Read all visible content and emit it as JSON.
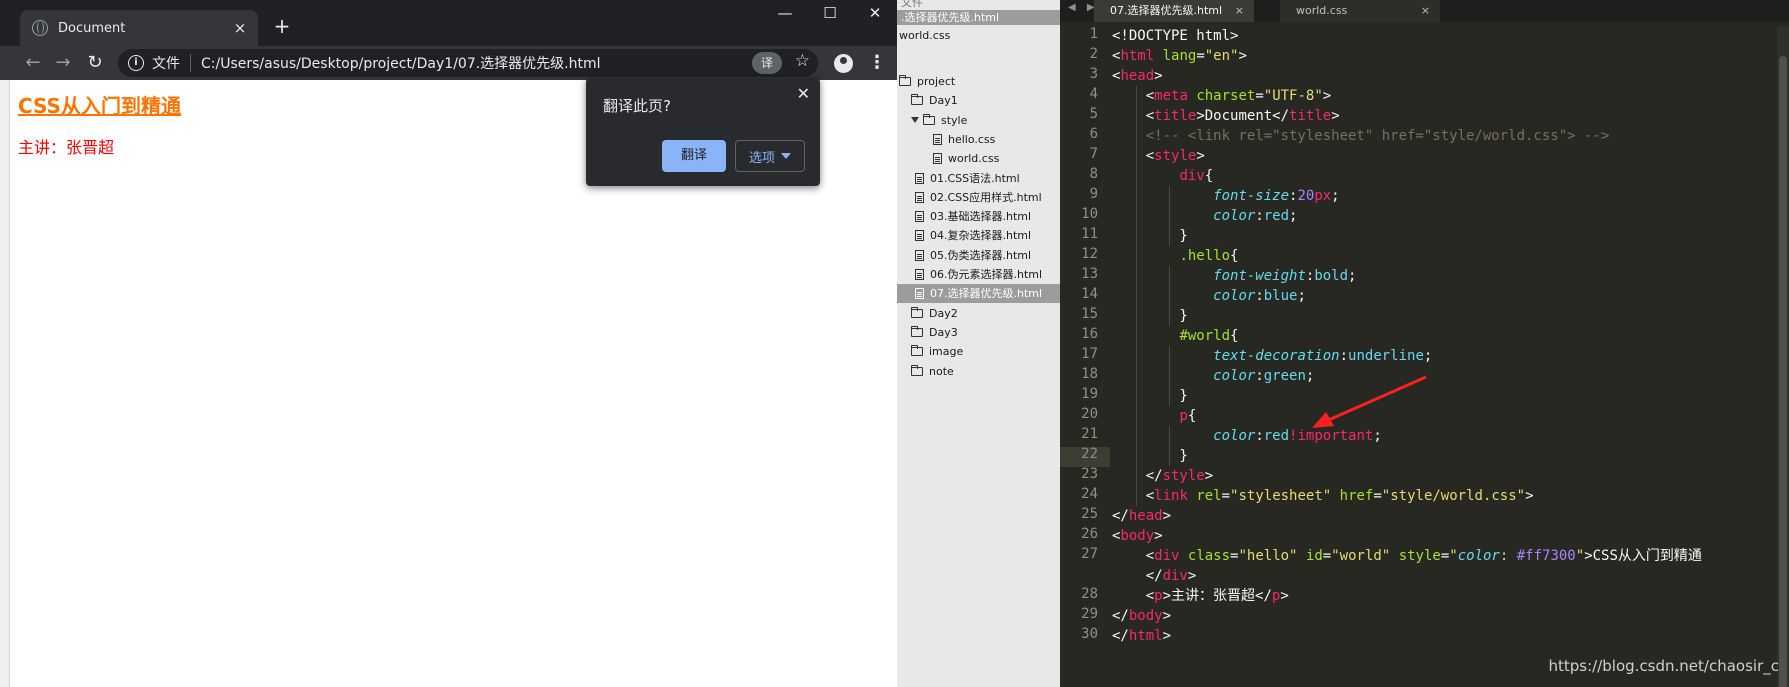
{
  "browser": {
    "tab_title": "Document",
    "tab_close": "×",
    "new_tab": "+",
    "minimize": "—",
    "maximize": "☐",
    "close": "✕",
    "scheme_label": "文件",
    "address": "C:/Users/asus/Desktop/project/Day1/07.选择器优先级.html",
    "translate_badge": "译",
    "page": {
      "heading": "CSS从入门到精通",
      "paragraph": "主讲：张晋超"
    },
    "translate_popup": {
      "prompt": "翻译此页?",
      "translate_button": "翻译",
      "options_button": "选项",
      "close": "✕"
    }
  },
  "sidebar": {
    "top_stub": "文件",
    "open_file_selected": ".选择器优先级.html",
    "open_file_2": "world.css",
    "tree": [
      {
        "label": "project",
        "type": "folder",
        "level": 0
      },
      {
        "label": "Day1",
        "type": "folder",
        "level": 1
      },
      {
        "label": "style",
        "type": "folder-open",
        "level": 2
      },
      {
        "label": "hello.css",
        "type": "file",
        "level": 3
      },
      {
        "label": "world.css",
        "type": "file",
        "level": 3
      },
      {
        "label": "01.CSS语法.html",
        "type": "file",
        "level": 2
      },
      {
        "label": "02.CSS应用样式.html",
        "type": "file",
        "level": 2
      },
      {
        "label": "03.基础选择器.html",
        "type": "file",
        "level": 2
      },
      {
        "label": "04.复杂选择器.html",
        "type": "file",
        "level": 2
      },
      {
        "label": "05.伪类选择器.html",
        "type": "file",
        "level": 2
      },
      {
        "label": "06.伪元素选择器.html",
        "type": "file",
        "level": 2
      },
      {
        "label": "07.选择器优先级.html",
        "type": "file",
        "level": 2,
        "selected": true
      },
      {
        "label": "Day2",
        "type": "folder",
        "level": 1
      },
      {
        "label": "Day3",
        "type": "folder",
        "level": 1
      },
      {
        "label": "image",
        "type": "folder",
        "level": 1
      },
      {
        "label": "note",
        "type": "folder",
        "level": 1
      }
    ]
  },
  "editor": {
    "tabs": [
      {
        "label": "07.选择器优先级.html",
        "active": true
      },
      {
        "label": "world.css",
        "active": false
      }
    ],
    "tab_close": "×",
    "line_numbers": [
      "1",
      "2",
      "3",
      "4",
      "5",
      "6",
      "7",
      "8",
      "9",
      "10",
      "11",
      "12",
      "13",
      "14",
      "15",
      "16",
      "17",
      "18",
      "19",
      "20",
      "21",
      "22",
      "23",
      "24",
      "25",
      "26",
      "27",
      "",
      "28",
      "29",
      "30"
    ],
    "lines": [
      [
        [
          "t-plain",
          "<!DOCTYPE html>"
        ]
      ],
      [
        [
          "t-plain",
          "<"
        ],
        [
          "t-tag",
          "html"
        ],
        [
          "t-plain",
          " "
        ],
        [
          "t-attr",
          "lang"
        ],
        [
          "t-plain",
          "="
        ],
        [
          "t-str",
          "\"en\""
        ],
        [
          "t-plain",
          ">"
        ]
      ],
      [
        [
          "t-plain",
          "<"
        ],
        [
          "t-tag",
          "head"
        ],
        [
          "t-plain",
          ">"
        ]
      ],
      [
        [
          "t-plain",
          "    <"
        ],
        [
          "t-tag",
          "meta"
        ],
        [
          "t-plain",
          " "
        ],
        [
          "t-attr",
          "charset"
        ],
        [
          "t-plain",
          "="
        ],
        [
          "t-str",
          "\"UTF-8\""
        ],
        [
          "t-plain",
          ">"
        ]
      ],
      [
        [
          "t-plain",
          "    <"
        ],
        [
          "t-tag",
          "title"
        ],
        [
          "t-plain",
          ">Document</"
        ],
        [
          "t-tag",
          "title"
        ],
        [
          "t-plain",
          ">"
        ]
      ],
      [
        [
          "t-com",
          "    <!-- <link rel=\"stylesheet\" href=\"style/world.css\"> -->"
        ]
      ],
      [
        [
          "t-plain",
          "    <"
        ],
        [
          "t-tag",
          "style"
        ],
        [
          "t-plain",
          ">"
        ]
      ],
      [
        [
          "t-plain",
          "        "
        ],
        [
          "t-tag",
          "div"
        ],
        [
          "t-plain",
          "{"
        ]
      ],
      [
        [
          "t-plain",
          "            "
        ],
        [
          "t-prop",
          "font-size"
        ],
        [
          "t-plain",
          ":"
        ],
        [
          "t-num",
          "20"
        ],
        [
          "t-tag",
          "px"
        ],
        [
          "t-plain",
          ";"
        ]
      ],
      [
        [
          "t-plain",
          "            "
        ],
        [
          "t-prop",
          "color"
        ],
        [
          "t-plain",
          ":"
        ],
        [
          "t-val",
          "red"
        ],
        [
          "t-plain",
          ";"
        ]
      ],
      [
        [
          "t-plain",
          "        }"
        ]
      ],
      [
        [
          "t-plain",
          "        "
        ],
        [
          "t-sel",
          ".hello"
        ],
        [
          "t-plain",
          "{"
        ]
      ],
      [
        [
          "t-plain",
          "            "
        ],
        [
          "t-prop",
          "font-weight"
        ],
        [
          "t-plain",
          ":"
        ],
        [
          "t-val",
          "bold"
        ],
        [
          "t-plain",
          ";"
        ]
      ],
      [
        [
          "t-plain",
          "            "
        ],
        [
          "t-prop",
          "color"
        ],
        [
          "t-plain",
          ":"
        ],
        [
          "t-val",
          "blue"
        ],
        [
          "t-plain",
          ";"
        ]
      ],
      [
        [
          "t-plain",
          "        }"
        ]
      ],
      [
        [
          "t-plain",
          "        "
        ],
        [
          "t-sel",
          "#world"
        ],
        [
          "t-plain",
          "{"
        ]
      ],
      [
        [
          "t-plain",
          "            "
        ],
        [
          "t-prop",
          "text-decoration"
        ],
        [
          "t-plain",
          ":"
        ],
        [
          "t-val",
          "underline"
        ],
        [
          "t-plain",
          ";"
        ]
      ],
      [
        [
          "t-plain",
          "            "
        ],
        [
          "t-prop",
          "color"
        ],
        [
          "t-plain",
          ":"
        ],
        [
          "t-val",
          "green"
        ],
        [
          "t-plain",
          ";"
        ]
      ],
      [
        [
          "t-plain",
          "        }"
        ]
      ],
      [
        [
          "t-plain",
          "        "
        ],
        [
          "t-tag",
          "p"
        ],
        [
          "t-plain",
          "{"
        ]
      ],
      [
        [
          "t-plain",
          "            "
        ],
        [
          "t-prop",
          "color"
        ],
        [
          "t-plain",
          ":"
        ],
        [
          "t-val",
          "red"
        ],
        [
          "t-imp",
          "!important"
        ],
        [
          "t-plain",
          ";"
        ]
      ],
      [
        [
          "t-plain",
          "        }"
        ]
      ],
      [
        [
          "t-plain",
          "    </"
        ],
        [
          "t-tag",
          "style"
        ],
        [
          "t-plain",
          ">"
        ]
      ],
      [
        [
          "t-plain",
          "    <"
        ],
        [
          "t-tag",
          "link"
        ],
        [
          "t-plain",
          " "
        ],
        [
          "t-attr",
          "rel"
        ],
        [
          "t-plain",
          "="
        ],
        [
          "t-str",
          "\"stylesheet\""
        ],
        [
          "t-plain",
          " "
        ],
        [
          "t-attr",
          "href"
        ],
        [
          "t-plain",
          "="
        ],
        [
          "t-str",
          "\"style/world.css\""
        ],
        [
          "t-plain",
          ">"
        ]
      ],
      [
        [
          "t-plain",
          "</"
        ],
        [
          "t-tag",
          "head"
        ],
        [
          "t-plain",
          ">"
        ]
      ],
      [
        [
          "t-plain",
          "<"
        ],
        [
          "t-tag",
          "body"
        ],
        [
          "t-plain",
          ">"
        ]
      ],
      [
        [
          "t-plain",
          "    <"
        ],
        [
          "t-tag",
          "div"
        ],
        [
          "t-plain",
          " "
        ],
        [
          "t-attr",
          "class"
        ],
        [
          "t-plain",
          "="
        ],
        [
          "t-str",
          "\"hello\""
        ],
        [
          "t-plain",
          " "
        ],
        [
          "t-attr",
          "id"
        ],
        [
          "t-plain",
          "="
        ],
        [
          "t-str",
          "\"world\""
        ],
        [
          "t-plain",
          " "
        ],
        [
          "t-attr",
          "style"
        ],
        [
          "t-plain",
          "="
        ],
        [
          "t-str",
          "\""
        ],
        [
          "t-prop",
          "color"
        ],
        [
          "t-str",
          ": "
        ],
        [
          "t-num",
          "#ff7300"
        ],
        [
          "t-str",
          "\""
        ],
        [
          "t-plain",
          ">CSS从入门到精通"
        ]
      ],
      [
        [
          "t-plain",
          "    </"
        ],
        [
          "t-tag",
          "div"
        ],
        [
          "t-plain",
          ">"
        ]
      ],
      [
        [
          "t-plain",
          "    <"
        ],
        [
          "t-tag",
          "p"
        ],
        [
          "t-plain",
          ">主讲：张晋超</"
        ],
        [
          "t-tag",
          "p"
        ],
        [
          "t-plain",
          ">"
        ]
      ],
      [
        [
          "t-plain",
          "</"
        ],
        [
          "t-tag",
          "body"
        ],
        [
          "t-plain",
          ">"
        ]
      ],
      [
        [
          "t-plain",
          "</"
        ],
        [
          "t-tag",
          "html"
        ],
        [
          "t-plain",
          ">"
        ]
      ]
    ],
    "watermark": "https://blog.csdn.net/chaosir_c"
  },
  "colors": {
    "heading": "#ff7300",
    "paragraph": "#ff0000",
    "arrow": "#ff2020"
  }
}
